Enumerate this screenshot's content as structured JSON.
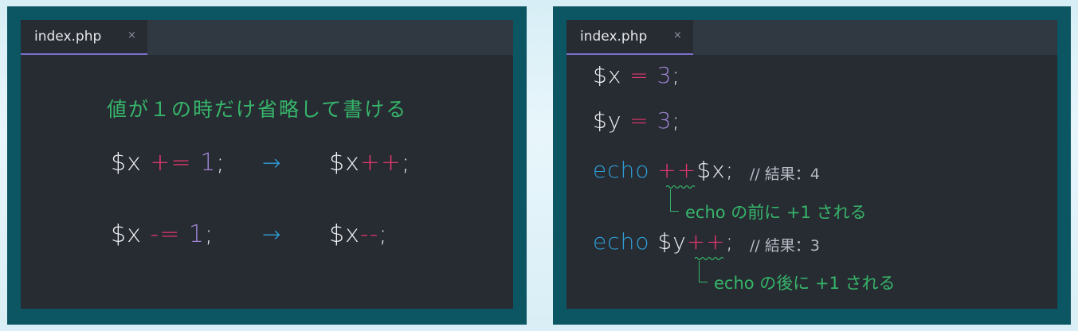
{
  "left_panel": {
    "tab": {
      "label": "index.php",
      "close_glyph": "×"
    },
    "heading": "値が１の時だけ省略して書ける",
    "rows": [
      {
        "before": {
          "var": "$x",
          "op": "+=",
          "num": "1",
          "semi": ";"
        },
        "arrow": "→",
        "after": {
          "var": "$x",
          "op": "++",
          "semi": ";"
        }
      },
      {
        "before": {
          "var": "$x",
          "op": "-=",
          "num": "1",
          "semi": ";"
        },
        "arrow": "→",
        "after": {
          "var": "$x",
          "op": "--",
          "semi": ";"
        }
      }
    ]
  },
  "right_panel": {
    "tab": {
      "label": "index.php",
      "close_glyph": "×"
    },
    "lines": [
      {
        "var": "$x",
        "op": "=",
        "num": "3",
        "semi": ";"
      },
      {
        "var": "$y",
        "op": "=",
        "num": "3",
        "semi": ";"
      }
    ],
    "echo_pre": {
      "keyword": "echo",
      "op": "++",
      "var": "$x",
      "semi": ";",
      "comment": "// 結果：4",
      "note": "echo の前に +1 される"
    },
    "echo_post": {
      "keyword": "echo",
      "var": "$y",
      "op": "++",
      "semi": ";",
      "comment": "// 結果：3",
      "note": "echo の後に +1 される"
    }
  },
  "colors": {
    "panel_frame": "#0c5562",
    "editor_bg": "#272b32",
    "tab_underline": "#7b6fc9",
    "variable": "#eef0f2",
    "operator": "#e6386e",
    "number": "#9f86d6",
    "keyword": "#2f9fd8",
    "annotation": "#36b56a"
  }
}
